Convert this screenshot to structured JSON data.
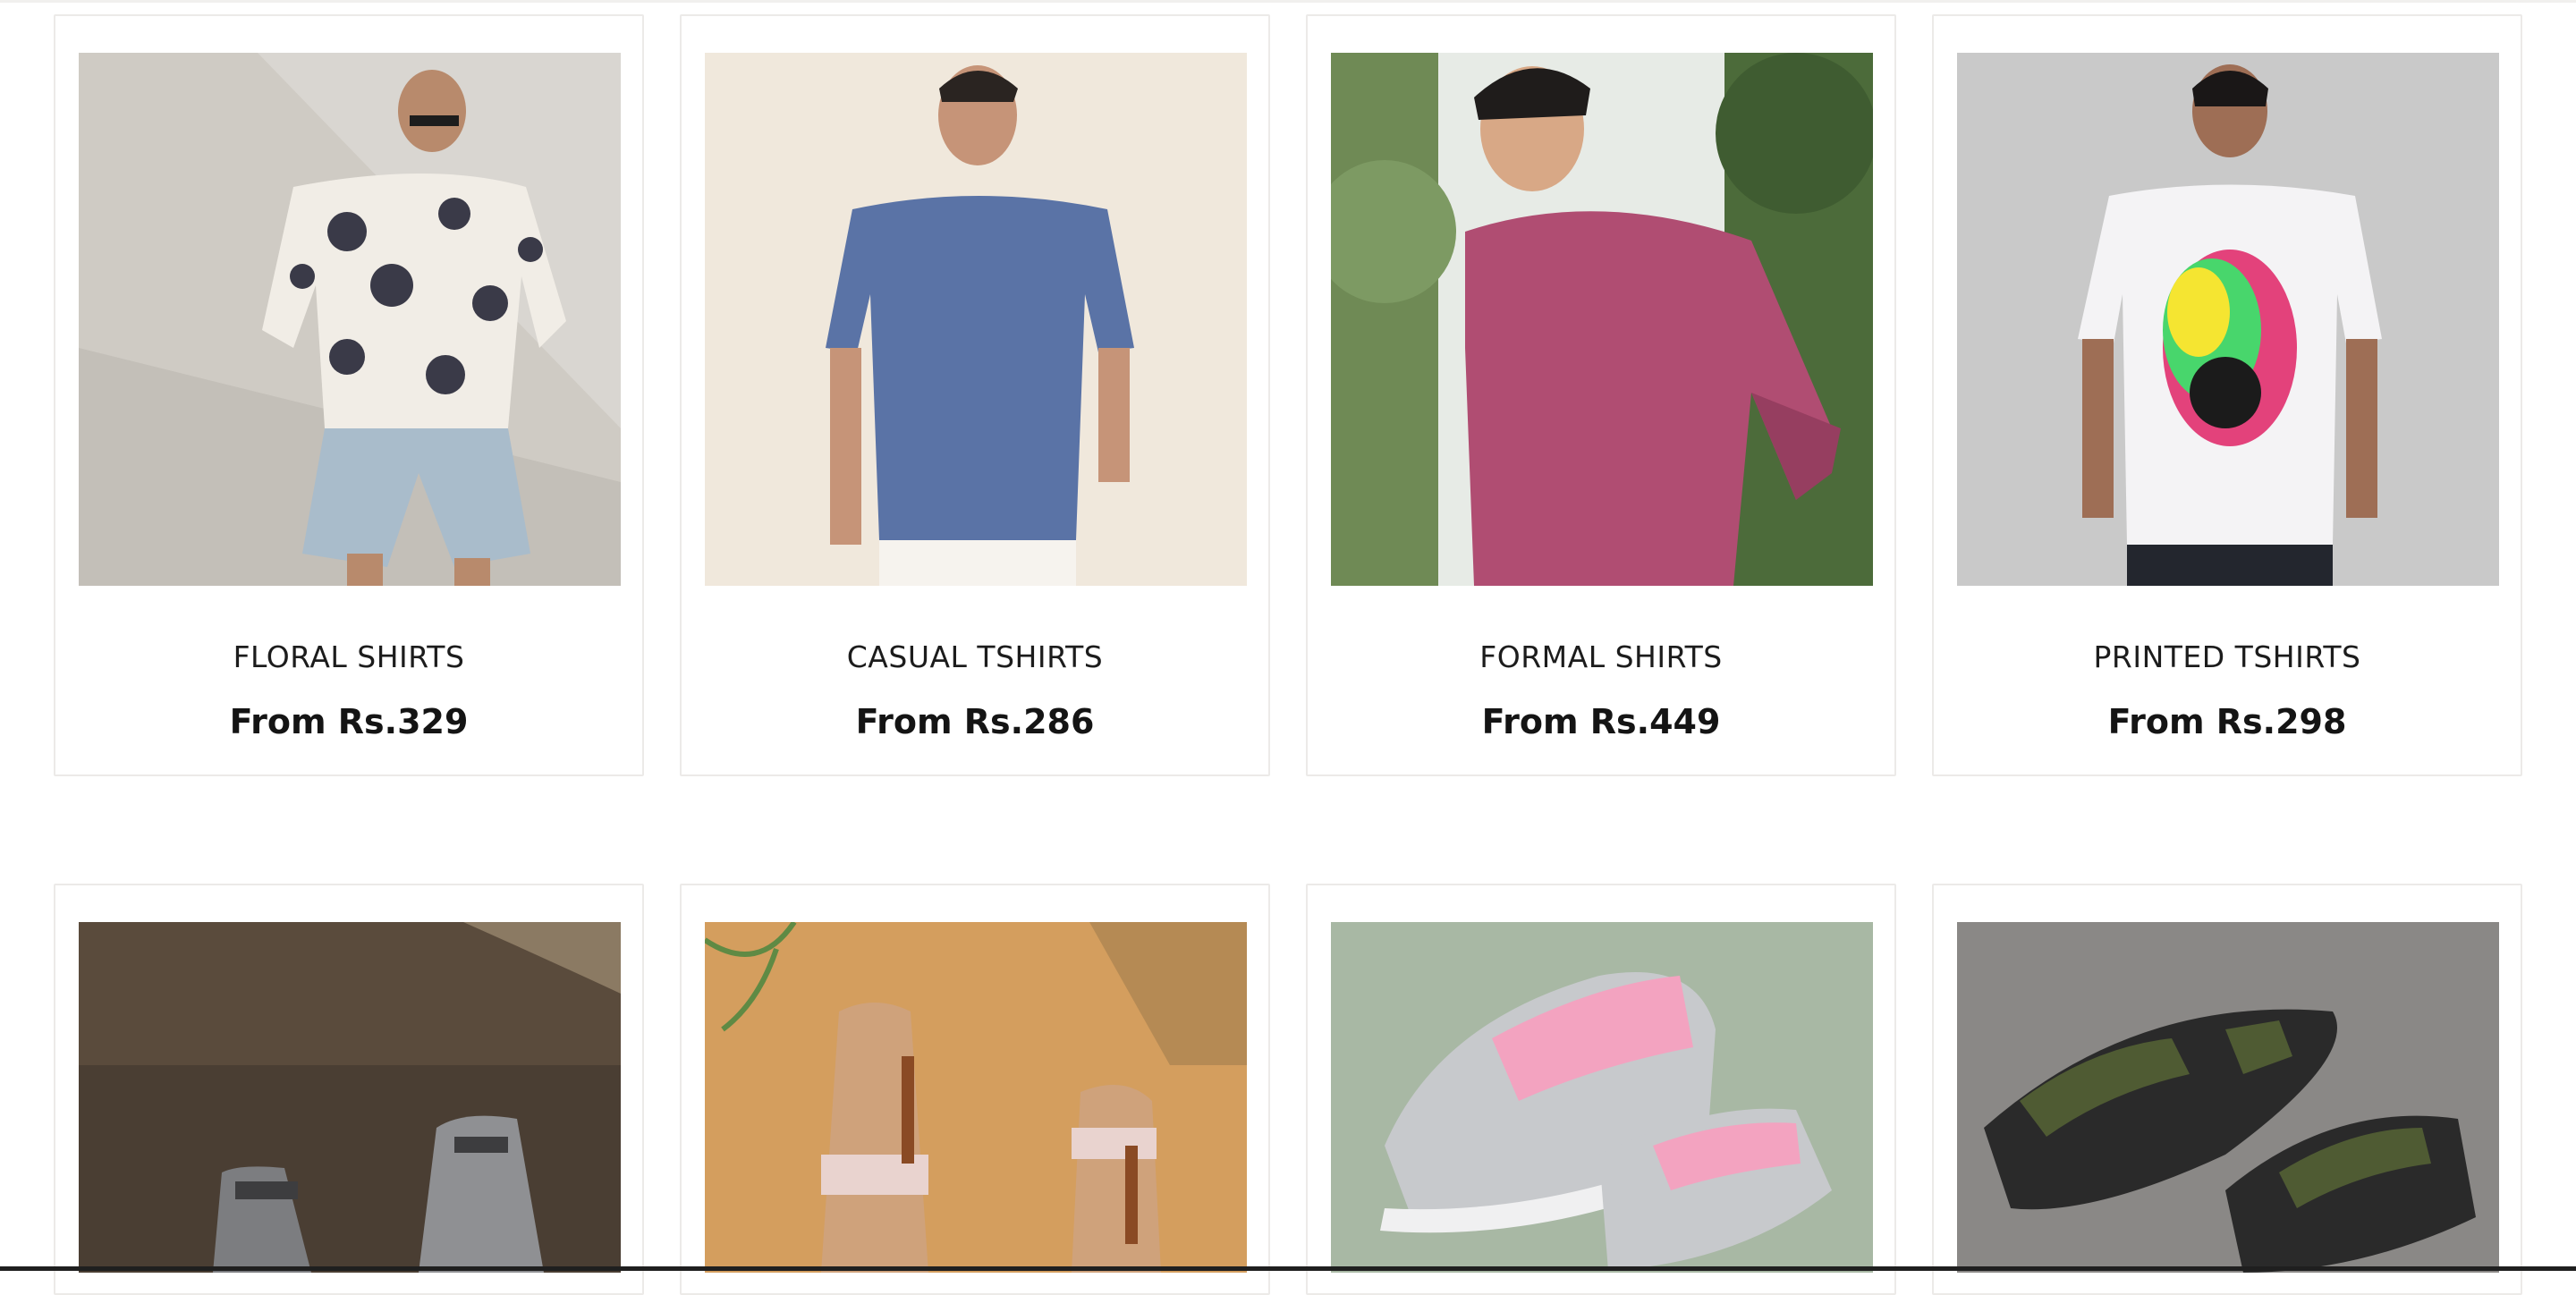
{
  "categories": [
    {
      "title": "FLORAL SHIRTS",
      "price": "From Rs.329",
      "image": "man-in-floral-shirt-photo"
    },
    {
      "title": "CASUAL TSHIRTS",
      "price": "From Rs.286",
      "image": "man-in-blue-tshirt-photo"
    },
    {
      "title": "FORMAL SHIRTS",
      "price": "From Rs.449",
      "image": "man-in-pink-formal-shirt-photo"
    },
    {
      "title": "PRINTED TSHIRTS",
      "price": "From Rs.298",
      "image": "man-in-printed-skull-tshirt-photo"
    }
  ],
  "footwear": [
    {
      "image": "grey-sneakers-photo"
    },
    {
      "image": "flat-sandals-photo"
    },
    {
      "image": "pink-grey-running-shoes-photo"
    },
    {
      "image": "olive-sports-sandals-photo"
    }
  ]
}
